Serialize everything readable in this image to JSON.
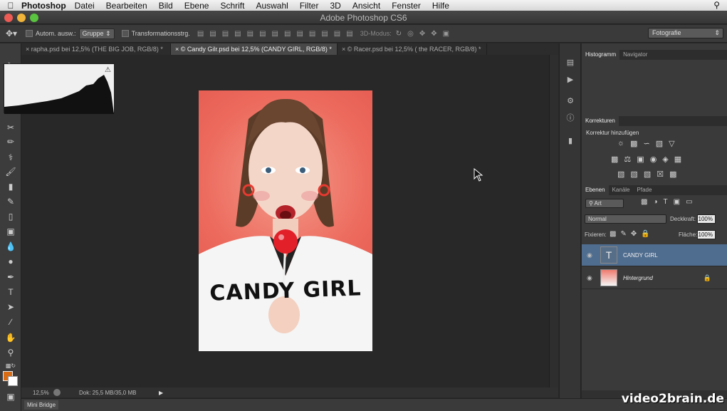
{
  "menubar": {
    "app_name": "Photoshop",
    "items": [
      "Datei",
      "Bearbeiten",
      "Bild",
      "Ebene",
      "Schrift",
      "Auswahl",
      "Filter",
      "3D",
      "Ansicht",
      "Fenster",
      "Hilfe"
    ]
  },
  "window": {
    "title": "Adobe Photoshop CS6"
  },
  "options_bar": {
    "auto_select_label": "Autom. ausw.:",
    "auto_select_value": "Gruppe",
    "transform_label": "Transformationsstrg.",
    "mode_3d_label": "3D-Modus:",
    "workspace": "Fotografie"
  },
  "tabs": [
    {
      "label": "rapha.psd bei 12,5% (THE  BIG JOB, RGB/8) *",
      "active": false
    },
    {
      "label": "© Candy Gilr.psd bei 12,5% (CANDY GIRL, RGB/8) *",
      "active": true
    },
    {
      "label": "© Racer.psd bei 12,5% (     the RACER, RGB/8) *",
      "active": false
    }
  ],
  "canvas": {
    "text_overlay": "CANDY GIRL"
  },
  "status": {
    "zoom": "12,5%",
    "doc_info": "Dok: 25,5 MB/35,0 MB"
  },
  "mini_bridge": {
    "label": "Mini Bridge"
  },
  "panels": {
    "histogram_tabs": [
      "Histogramm",
      "Navigator"
    ],
    "corrections_tab": "Korrekturen",
    "corrections_subtitle": "Korrektur hinzufügen",
    "layers_tabs": [
      "Ebenen",
      "Kanäle",
      "Pfade"
    ],
    "filter_kind": "Art",
    "blend_mode": "Normal",
    "opacity_label": "Deckkraft:",
    "opacity_value": "100%",
    "lock_label": "Fixieren:",
    "fill_label": "Fläche:",
    "fill_value": "100%",
    "layers": [
      {
        "name": "CANDY GIRL",
        "type": "text",
        "selected": true
      },
      {
        "name": "Hintergrund",
        "type": "image",
        "selected": false
      }
    ]
  },
  "colors": {
    "foreground": "#d86c14",
    "background": "#ffffff",
    "accent": "#4f6d8f"
  },
  "watermark": "video2brain.de"
}
